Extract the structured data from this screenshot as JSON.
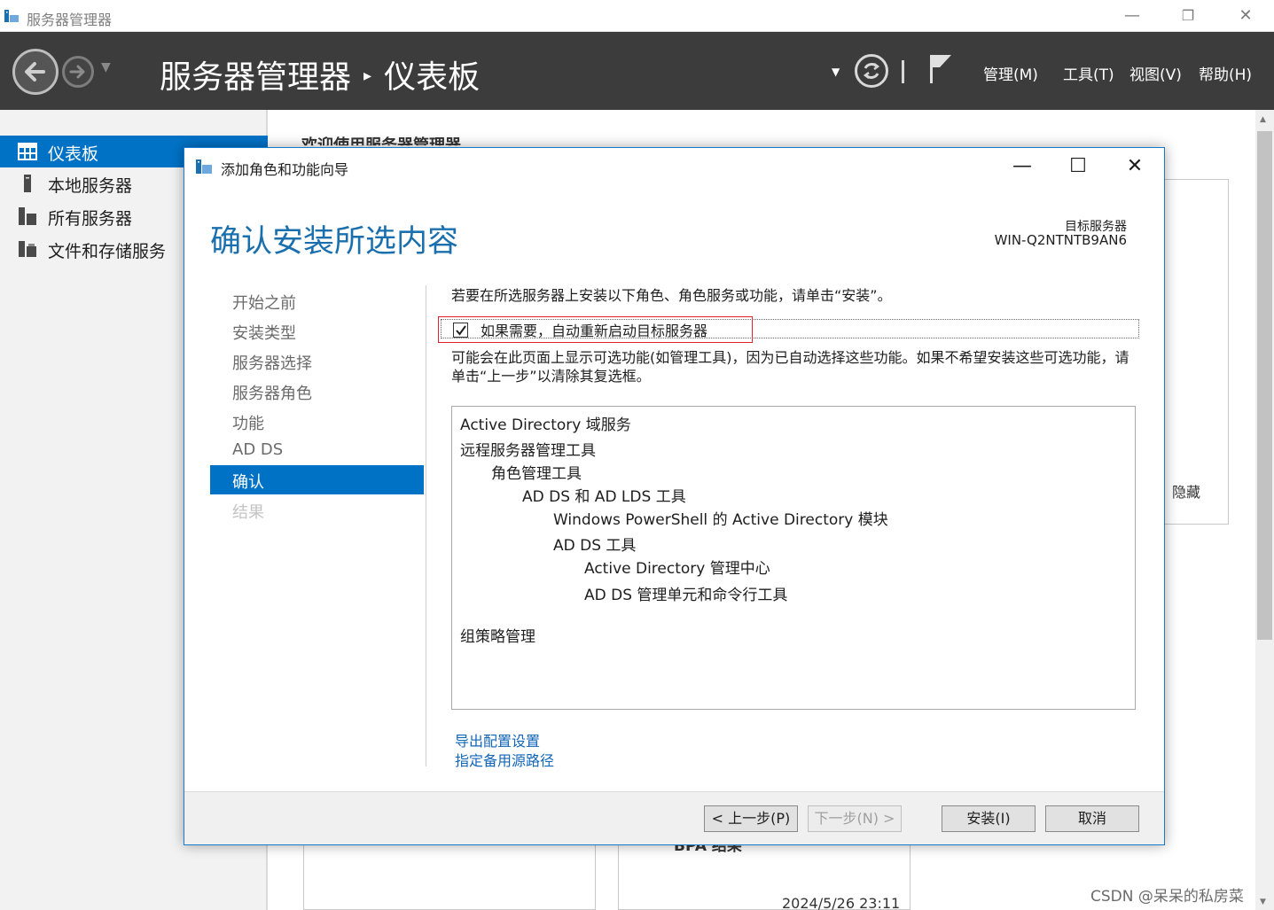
{
  "window": {
    "title": "服务器管理器",
    "controls": {
      "minimize": "—",
      "restore": "❐",
      "close": "✕"
    }
  },
  "header": {
    "breadcrumb_app": "服务器管理器",
    "breadcrumb_separator": "▸",
    "breadcrumb_page": "仪表板",
    "menus": [
      "管理(M)",
      "工具(T)",
      "视图(V)",
      "帮助(H)"
    ]
  },
  "sidebar": {
    "items": [
      {
        "label": "仪表板",
        "icon": "dashboard-icon",
        "active": true
      },
      {
        "label": "本地服务器",
        "icon": "server-icon",
        "active": false
      },
      {
        "label": "所有服务器",
        "icon": "servers-icon",
        "active": false
      },
      {
        "label": "文件和存储服务",
        "icon": "storage-icon",
        "active": false
      }
    ]
  },
  "background": {
    "welcome": "欢迎使用服务器管理器",
    "hide_label": "隐藏",
    "tile_title": "BPA 结果",
    "date": "2024/5/26 23:11"
  },
  "dialog": {
    "title": "添加角色和功能向导",
    "controls": {
      "minimize": "—",
      "maximize": "☐",
      "close": "✕"
    },
    "heading": "确认安装所选内容",
    "target_label": "目标服务器",
    "target_server": "WIN-Q2NTNTB9AN6",
    "steps": [
      {
        "label": "开始之前",
        "state": "normal"
      },
      {
        "label": "安装类型",
        "state": "normal"
      },
      {
        "label": "服务器选择",
        "state": "normal"
      },
      {
        "label": "服务器角色",
        "state": "normal"
      },
      {
        "label": "功能",
        "state": "normal"
      },
      {
        "label": "AD DS",
        "state": "normal"
      },
      {
        "label": "确认",
        "state": "active"
      },
      {
        "label": "结果",
        "state": "disabled"
      }
    ],
    "intro": "若要在所选服务器上安装以下角色、角色服务或功能，请单击“安装”。",
    "restart_checkbox": {
      "label": "如果需要，自动重新启动目标服务器",
      "checked": true
    },
    "note": "可能会在此页面上显示可选功能(如管理工具)，因为已自动选择这些功能。如果不希望安装这些可选功能，请单击“上一步”以清除其复选框。",
    "features": [
      {
        "text": "Active Directory 域服务",
        "level": 0
      },
      {
        "text": "远程服务器管理工具",
        "level": 0
      },
      {
        "text": "角色管理工具",
        "level": 1
      },
      {
        "text": "AD DS 和 AD LDS 工具",
        "level": 2
      },
      {
        "text": "Windows PowerShell 的 Active Directory 模块",
        "level": 3
      },
      {
        "text": "AD DS 工具",
        "level": 3
      },
      {
        "text": "Active Directory 管理中心",
        "level": 4
      },
      {
        "text": "AD DS 管理单元和命令行工具",
        "level": 4
      },
      {
        "text": "组策略管理",
        "level": 0
      }
    ],
    "links": {
      "export": "导出配置设置",
      "alt_source": "指定备用源路径"
    },
    "buttons": {
      "previous": "< 上一步(P)",
      "next": "下一步(N) >",
      "install": "安装(I)",
      "cancel": "取消"
    }
  },
  "watermark": "CSDN @呆呆的私房菜",
  "colors": {
    "accent": "#0072c6",
    "header_bg": "#3c3c3c",
    "heading": "#1a6fae",
    "link": "#1266b8",
    "highlight_box": "#e0202b"
  }
}
